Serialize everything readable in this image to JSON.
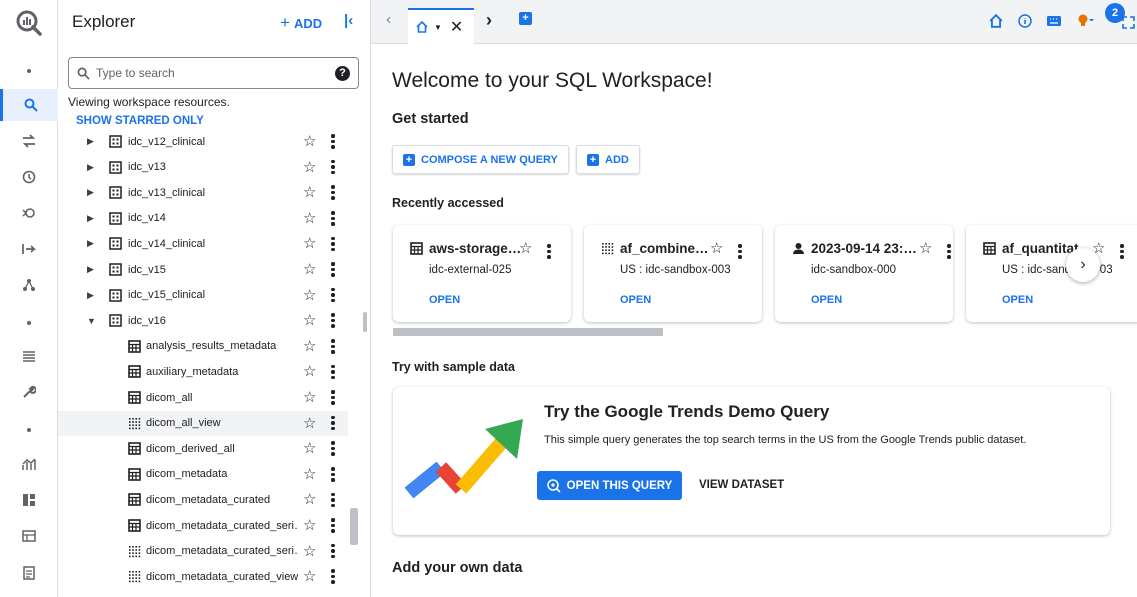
{
  "explorer": {
    "title": "Explorer",
    "add_label": "ADD",
    "search_placeholder": "Type to search",
    "viewing_text": "Viewing workspace resources.",
    "starred_label": "SHOW STARRED ONLY",
    "tree": [
      {
        "label": "idc_v12_clinical",
        "type": "dataset",
        "expanded": false
      },
      {
        "label": "idc_v13",
        "type": "dataset",
        "expanded": false
      },
      {
        "label": "idc_v13_clinical",
        "type": "dataset",
        "expanded": false
      },
      {
        "label": "idc_v14",
        "type": "dataset",
        "expanded": false
      },
      {
        "label": "idc_v14_clinical",
        "type": "dataset",
        "expanded": false
      },
      {
        "label": "idc_v15",
        "type": "dataset",
        "expanded": false
      },
      {
        "label": "idc_v15_clinical",
        "type": "dataset",
        "expanded": false
      },
      {
        "label": "idc_v16",
        "type": "dataset",
        "expanded": true
      },
      {
        "label": "analysis_results_metadata",
        "type": "table"
      },
      {
        "label": "auxiliary_metadata",
        "type": "table"
      },
      {
        "label": "dicom_all",
        "type": "table"
      },
      {
        "label": "dicom_all_view",
        "type": "view",
        "hovered": true
      },
      {
        "label": "dicom_derived_all",
        "type": "table"
      },
      {
        "label": "dicom_metadata",
        "type": "table"
      },
      {
        "label": "dicom_metadata_curated",
        "type": "table"
      },
      {
        "label": "dicom_metadata_curated_seri…",
        "type": "table"
      },
      {
        "label": "dicom_metadata_curated_seri…",
        "type": "view"
      },
      {
        "label": "dicom_metadata_curated_view",
        "type": "view"
      }
    ]
  },
  "tabs": {
    "notification_count": "2"
  },
  "main": {
    "welcome": "Welcome to your SQL Workspace!",
    "get_started": "Get started",
    "compose_label": "COMPOSE A NEW QUERY",
    "add_label": "ADD",
    "recently_accessed": "Recently accessed",
    "recent": [
      {
        "name": "aws-storage…",
        "sub": "idc-external-025",
        "open": "OPEN",
        "icon": "table-icon"
      },
      {
        "name": "af_combine…",
        "sub": "US : idc-sandbox-003",
        "open": "OPEN",
        "icon": "view-icon"
      },
      {
        "name": "2023-09-14 23:…",
        "sub": "idc-sandbox-000",
        "open": "OPEN",
        "icon": "person-icon"
      },
      {
        "name": "af_quantitat",
        "sub": "US : idc-sandbox-003",
        "open": "OPEN",
        "icon": "table-icon"
      }
    ],
    "try_sample": "Try with sample data",
    "demo": {
      "title": "Try the Google Trends Demo Query",
      "description": "This simple query generates the top search terms in the US from the Google Trends public dataset.",
      "open_label": "OPEN THIS QUERY",
      "view_label": "VIEW DATASET"
    },
    "add_own": "Add your own data"
  },
  "colors": {
    "accent": "#1a73e8",
    "trend_blue": "#4285f4",
    "trend_red": "#ea4335",
    "trend_yellow": "#fbbc04",
    "trend_green": "#34a853"
  }
}
